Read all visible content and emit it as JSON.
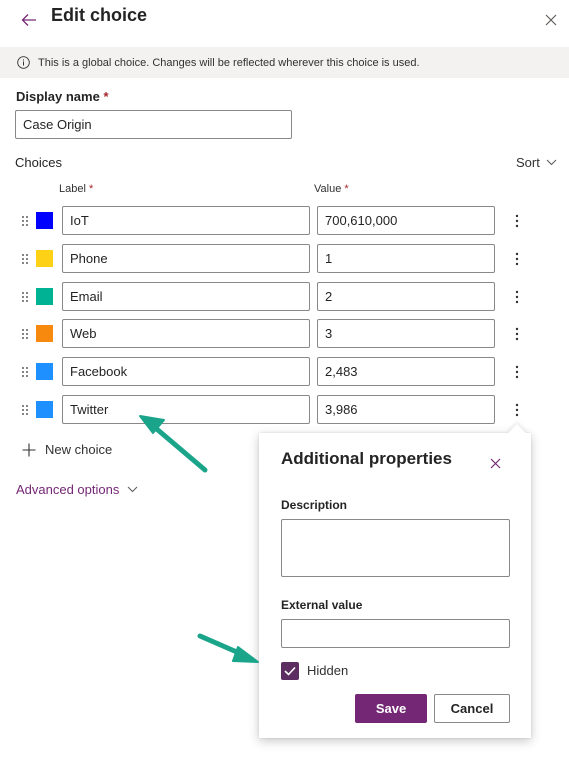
{
  "header": {
    "title": "Edit choice",
    "back_icon": "arrow-left-icon",
    "close_icon": "close-icon"
  },
  "banner": {
    "icon": "info-icon",
    "text": "This is a global choice. Changes will be reflected wherever this choice is used."
  },
  "display_name": {
    "label": "Display name",
    "required_mark": "*",
    "value": "Case Origin"
  },
  "choices": {
    "section_label": "Choices",
    "sort_label": "Sort",
    "label_column": "Label",
    "value_column": "Value",
    "required_mark": "*",
    "rows": [
      {
        "label": "IoT",
        "value": "700,610,000",
        "color": "#0000ff"
      },
      {
        "label": "Phone",
        "value": "1",
        "color": "#fcd116"
      },
      {
        "label": "Email",
        "value": "2",
        "color": "#00b294"
      },
      {
        "label": "Web",
        "value": "3",
        "color": "#f7890f"
      },
      {
        "label": "Facebook",
        "value": "2,483",
        "color": "#1e90ff"
      },
      {
        "label": "Twitter",
        "value": "3,986",
        "color": "#1e90ff"
      }
    ],
    "new_choice_label": "New choice",
    "advanced_label": "Advanced options"
  },
  "popup": {
    "title": "Additional properties",
    "description_label": "Description",
    "description_value": "",
    "external_value_label": "External value",
    "external_value": "",
    "hidden_label": "Hidden",
    "hidden_checked": true,
    "save_label": "Save",
    "cancel_label": "Cancel"
  },
  "colors": {
    "accent": "#742774",
    "checkbox": "#5c2d61",
    "annotation_arrow": "#1aa58a",
    "required": "#a4262c"
  }
}
